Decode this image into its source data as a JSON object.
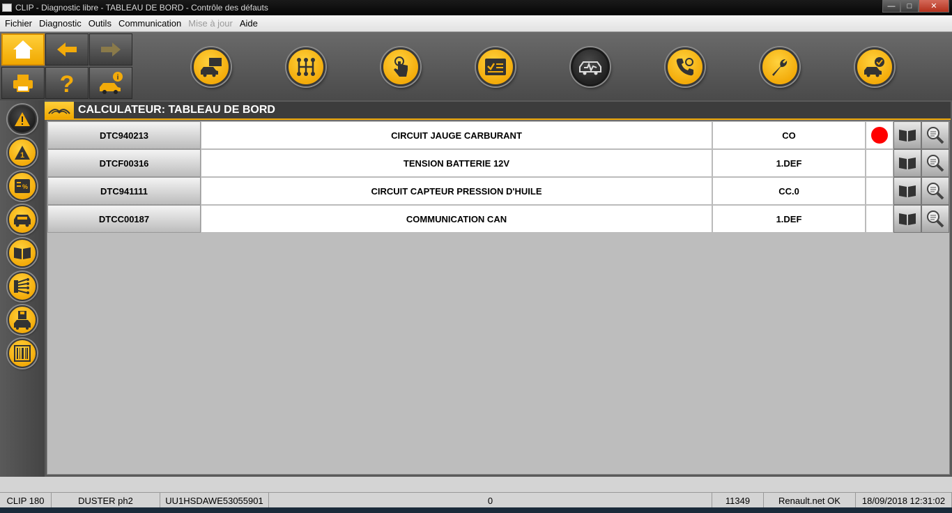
{
  "window": {
    "title": "CLIP - Diagnostic libre - TABLEAU DE BORD - Contrôle des défauts"
  },
  "menu": {
    "items": [
      {
        "label": "Fichier",
        "enabled": true
      },
      {
        "label": "Diagnostic",
        "enabled": true
      },
      {
        "label": "Outils",
        "enabled": true
      },
      {
        "label": "Communication",
        "enabled": true
      },
      {
        "label": "Mise à jour",
        "enabled": false
      },
      {
        "label": "Aide",
        "enabled": true
      }
    ]
  },
  "panel": {
    "title": "CALCULATEUR:  TABLEAU DE BORD"
  },
  "dtc": [
    {
      "code": "DTC940213",
      "description": "CIRCUIT JAUGE CARBURANT",
      "status": "CO",
      "active": true
    },
    {
      "code": "DTCF00316",
      "description": "TENSION BATTERIE 12V",
      "status": "1.DEF",
      "active": false
    },
    {
      "code": "DTC941111",
      "description": "CIRCUIT CAPTEUR PRESSION D'HUILE",
      "status": "CC.0",
      "active": false
    },
    {
      "code": "DTCC00187",
      "description": "COMMUNICATION CAN",
      "status": "1.DEF",
      "active": false
    }
  ],
  "status_bar": {
    "tool": "CLIP 180",
    "vehicle": "DUSTER ph2",
    "vin": "UU1HSDAWE53055901",
    "counter": "0",
    "code": "11349",
    "network": "Renault.net OK",
    "datetime": "18/09/2018 12:31:02"
  },
  "colors": {
    "accent": "#f3ab0a",
    "active_fault": "#ff0000",
    "header_bg": "#3c3c3c"
  },
  "icons": {
    "toolbar": [
      "home-icon",
      "back-arrow-icon",
      "forward-arrow-icon",
      "print-icon",
      "help-icon",
      "vehicle-info-icon"
    ],
    "tools": [
      "vehicle-identification-icon",
      "gearbox-icon",
      "touch-icon",
      "checklist-icon",
      "fault-diagnosis-icon",
      "phone-support-icon",
      "wrench-icon",
      "vehicle-check-icon"
    ],
    "sidebar": [
      "warning-icon",
      "alert-icon",
      "parameters-icon",
      "vehicle-icon",
      "book-icon",
      "wiring-icon",
      "save-vehicle-icon",
      "barcode-icon"
    ]
  }
}
